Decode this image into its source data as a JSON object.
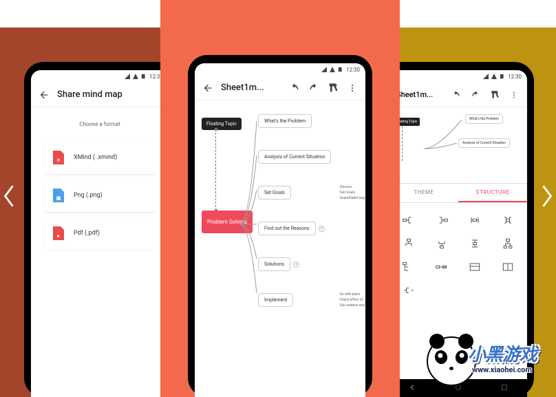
{
  "statusbar": {
    "time": "12:30"
  },
  "screenLeft": {
    "title": "Share mind map",
    "subtitle": "Choose a format",
    "formats": [
      {
        "label": "XMind ( .xmind)",
        "icon_style": "red",
        "glyph": "✕"
      },
      {
        "label": "Png (.png)",
        "icon_style": "blue",
        "glyph": "▣"
      },
      {
        "label": "Pdf (.pdf)",
        "icon_style": "red",
        "glyph": "▸"
      }
    ]
  },
  "screenCenter": {
    "title": "Sheet1m...",
    "floating": "Floating Topic",
    "central": "Problem Solving",
    "branches": [
      {
        "label": "What's the Problem",
        "subs": []
      },
      {
        "label": "Analysis of Current Situation",
        "subs": []
      },
      {
        "label": "Set Goals",
        "subs": [
          "Discuss",
          "Sub Goals",
          "Quantifiable targ"
        ]
      },
      {
        "label": "Find out the Reasons",
        "subs": [],
        "collapsed": true
      },
      {
        "label": "Solutions",
        "subs": [],
        "collapsed": true
      },
      {
        "label": "Implement",
        "subs": [
          "Go with plans",
          "Check effect of",
          "Sub useless way"
        ]
      }
    ]
  },
  "screenRight": {
    "title": "Sheet1m...",
    "floating": "Floating Topic",
    "branches": [
      "What's the Problem",
      "Analysis of Current Situation"
    ],
    "tabs": {
      "theme": "THEME",
      "structure": "STRUCTURE"
    }
  },
  "logo": {
    "text": "小黑游戏",
    "url": "www.xiaohei.com"
  }
}
